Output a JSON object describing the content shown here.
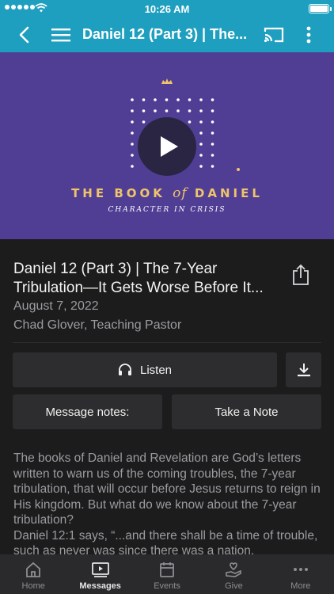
{
  "status_bar": {
    "time": "10:26 AM"
  },
  "app_bar": {
    "title": "Daniel 12 (Part 3) | The..."
  },
  "hero": {
    "series_title_before": "THE BOOK",
    "series_title_of": "of",
    "series_title_after": "DANIEL",
    "series_subtitle": "CHARACTER IN CRISIS"
  },
  "message": {
    "title_line1": "Daniel 12 (Part 3) | The 7-Year",
    "title_line2": "Tribulation—It Gets Worse Before It...",
    "date": "August 7, 2022",
    "speaker": "Chad Glover, Teaching Pastor"
  },
  "actions": {
    "listen": "Listen",
    "message_notes": "Message notes:",
    "take_note": "Take a Note"
  },
  "description": {
    "para1": "The books of Daniel and Revelation are God’s letters written to warn us of the coming troubles, the 7-year tribulation, that will occur before Jesus returns to reign in His kingdom. But what do we know about the 7-year tribulation?",
    "para2": "Daniel 12:1 says, “...and there shall be a time of trouble, such as never was since there was a nation,"
  },
  "tabs": [
    {
      "label": "Home",
      "icon": "home-icon"
    },
    {
      "label": "Messages",
      "icon": "messages-icon",
      "active": true
    },
    {
      "label": "Events",
      "icon": "calendar-icon"
    },
    {
      "label": "Give",
      "icon": "give-icon"
    },
    {
      "label": "More",
      "icon": "more-horizontal-icon"
    }
  ],
  "colors": {
    "accent": "#1f9fbf",
    "hero_bg": "#4f3e94",
    "gold": "#f0c46a"
  }
}
